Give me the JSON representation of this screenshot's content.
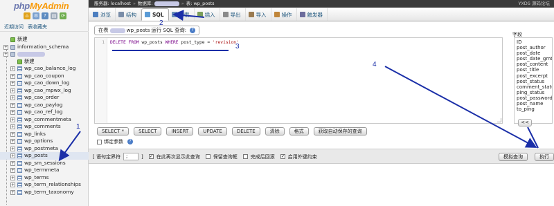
{
  "logo": {
    "part1": "php",
    "part2": "MyAdmin"
  },
  "nav": {
    "links": [
      "近期访问",
      "表收藏夹"
    ],
    "tree": [
      {
        "label": "新建",
        "type": "new",
        "indent": 0
      },
      {
        "label": "information_schema",
        "type": "db",
        "indent": 0
      },
      {
        "label": "",
        "type": "db-blur",
        "indent": 0
      },
      {
        "label": "新建",
        "type": "new",
        "indent": 1
      },
      {
        "label": "wp_cao_balance_log",
        "type": "table",
        "indent": 1
      },
      {
        "label": "wp_cao_coupon",
        "type": "table",
        "indent": 1
      },
      {
        "label": "wp_cao_down_log",
        "type": "table",
        "indent": 1
      },
      {
        "label": "wp_cao_mpwx_log",
        "type": "table",
        "indent": 1
      },
      {
        "label": "wp_cao_order",
        "type": "table",
        "indent": 1
      },
      {
        "label": "wp_cao_paylog",
        "type": "table",
        "indent": 1
      },
      {
        "label": "wp_cao_ref_log",
        "type": "table",
        "indent": 1
      },
      {
        "label": "wp_commentmeta",
        "type": "table",
        "indent": 1
      },
      {
        "label": "wp_comments",
        "type": "table",
        "indent": 1
      },
      {
        "label": "wp_links",
        "type": "table",
        "indent": 1
      },
      {
        "label": "wp_options",
        "type": "table",
        "indent": 1
      },
      {
        "label": "wp_postmeta",
        "type": "table",
        "indent": 1
      },
      {
        "label": "wp_posts",
        "type": "table",
        "indent": 1,
        "active": true
      },
      {
        "label": "wp_sm_sessions",
        "type": "table",
        "indent": 1
      },
      {
        "label": "wp_termmeta",
        "type": "table",
        "indent": 1
      },
      {
        "label": "wp_terms",
        "type": "table",
        "indent": 1
      },
      {
        "label": "wp_term_relationships",
        "type": "table",
        "indent": 1
      },
      {
        "label": "wp_term_taxonomy",
        "type": "table",
        "indent": 1
      }
    ]
  },
  "breadcrumb": {
    "server": "服务器: localhost",
    "db": "数据库:",
    "table": "表: wp_posts",
    "watermark": "YXDS 源码论坛"
  },
  "tabs": [
    {
      "label": "浏览",
      "icon": "browse-icon"
    },
    {
      "label": "结构",
      "icon": "structure-icon"
    },
    {
      "label": "SQL",
      "icon": "sql-icon",
      "active": true
    },
    {
      "label": "搜索",
      "icon": "search-icon"
    },
    {
      "label": "插入",
      "icon": "insert-icon"
    },
    {
      "label": "导出",
      "icon": "export-icon"
    },
    {
      "label": "导入",
      "icon": "import-icon"
    },
    {
      "label": "操作",
      "icon": "operations-icon"
    },
    {
      "label": "触发器",
      "icon": "triggers-icon"
    }
  ],
  "query": {
    "header_prefix": "在表",
    "header_table": "wp_posts",
    "header_suffix": "运行 SQL 查询:",
    "line_number": "1",
    "sql_kw1": "DELETE FROM",
    "sql_plain1": "wp_posts",
    "sql_kw2": "WHERE",
    "sql_plain2": "post_type =",
    "sql_str": "'revision'"
  },
  "columns": {
    "label": "字段",
    "items": [
      "ID",
      "post_author",
      "post_date",
      "post_date_gmt",
      "post_content",
      "post_title",
      "post_excerpt",
      "post_status",
      "comment_status",
      "ping_status",
      "post_password",
      "post_name",
      "to_ping"
    ],
    "insert_button": "<<"
  },
  "buttons": [
    "SELECT *",
    "SELECT",
    "INSERT",
    "UPDATE",
    "DELETE",
    "清除",
    "格式",
    "获取自动保存的查询"
  ],
  "bind_params": "绑定参数",
  "footer": {
    "delimiter_label": "[ 语句定界符",
    "delimiter_value": ";",
    "delimiter_close": "]",
    "options": [
      {
        "label": "在此再次显示此查询",
        "checked": true
      },
      {
        "label": "保留查询框",
        "checked": false
      },
      {
        "label": "完成后回滚",
        "checked": false
      },
      {
        "label": "启用外键约束",
        "checked": true
      }
    ],
    "simulate_button": "模拟查询",
    "go_button": "执行"
  },
  "annotations": [
    "1",
    "2",
    "3",
    "4"
  ],
  "colors": {
    "annotation": "#1b2fa8",
    "link": "#235a81",
    "logo_php": "#6c78af",
    "logo_myadmin": "#f89c0e"
  }
}
